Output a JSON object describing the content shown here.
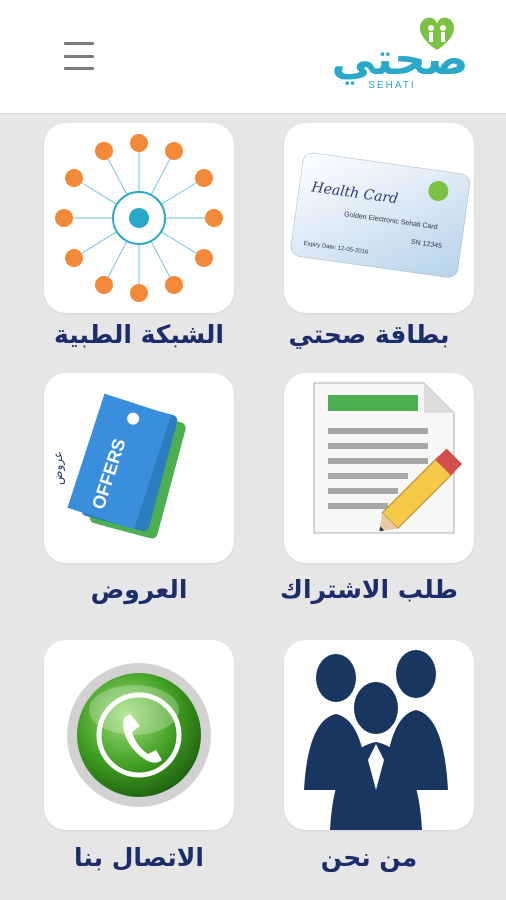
{
  "header": {
    "logo_text": "صحتي",
    "logo_subtext": "SEHATI"
  },
  "grid": {
    "items": [
      {
        "label": "بطاقة صحتي",
        "icon": "health-card-icon"
      },
      {
        "label": "الشبكة الطبية",
        "icon": "medical-network-icon"
      },
      {
        "label": "طلب الاشتراك",
        "icon": "subscription-form-icon"
      },
      {
        "label": "العروض",
        "icon": "offers-tags-icon"
      },
      {
        "label": "من نحن",
        "icon": "team-people-icon"
      },
      {
        "label": "الاتصال بنا",
        "icon": "phone-call-icon"
      }
    ]
  },
  "health_card": {
    "title": "Health Card",
    "subtitle": "Golden Electronic Sehati Card",
    "number": "SN 12345",
    "expiry": "Expiry Date: 12-05-2016"
  },
  "offers_tag": {
    "text": "OFFERS",
    "arabic": "عروض"
  }
}
